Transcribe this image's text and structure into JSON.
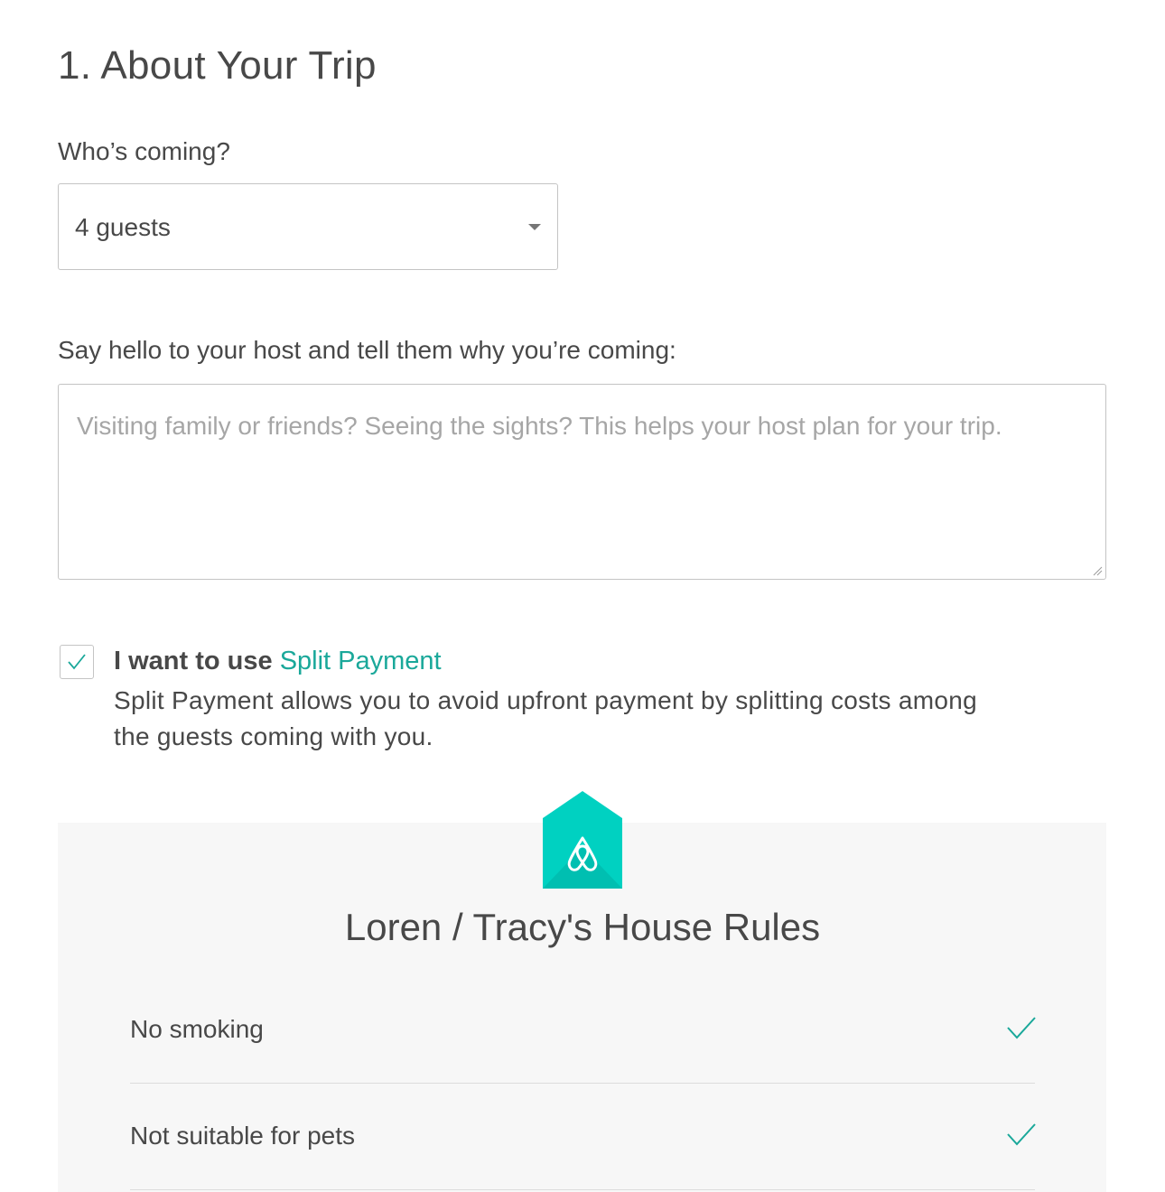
{
  "section": {
    "title": "1. About Your Trip"
  },
  "guests": {
    "label": "Who’s coming?",
    "selected": "4 guests"
  },
  "message": {
    "label": "Say hello to your host and tell them why you’re coming:",
    "placeholder": "Visiting family or friends? Seeing the sights? This helps your host plan for your trip.",
    "value": ""
  },
  "split_payment": {
    "checked": true,
    "prefix": "I want to use ",
    "link_label": "Split Payment",
    "description": "Split Payment allows you to avoid upfront payment by splitting costs among the guests coming with you."
  },
  "house_rules": {
    "title": "Loren / Tracy's House Rules",
    "rules": [
      {
        "label": "No smoking",
        "icon": "checkmark-icon"
      },
      {
        "label": "Not suitable for pets",
        "icon": "checkmark-icon"
      }
    ]
  },
  "colors": {
    "accent": "#1aa89a",
    "house_icon": "#00d1c1",
    "text": "#484848",
    "placeholder": "#a6a6a6",
    "panel_bg": "#f7f7f7"
  }
}
